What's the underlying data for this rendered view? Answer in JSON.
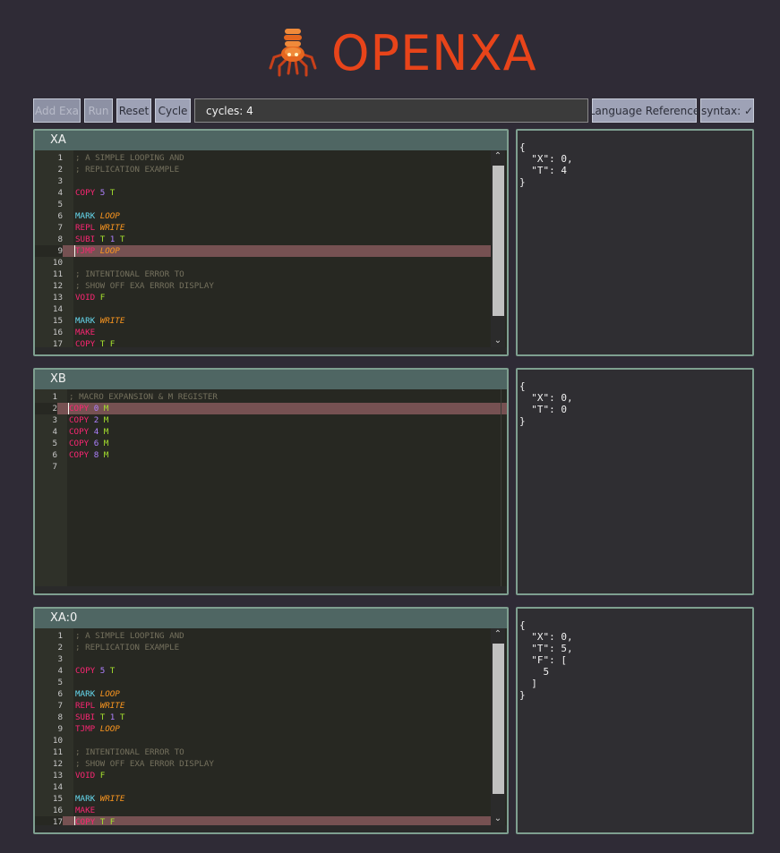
{
  "header": {
    "title": "OPENXA",
    "logo_icon": "robot-spider-icon"
  },
  "toolbar": {
    "add_exa_label": "Add Exa",
    "run_label": "Run",
    "reset_label": "Reset",
    "cycle_label": "Cycle",
    "status_text": "cycles: 4",
    "language_reference_label": "Language Reference",
    "syntax_label": "syntax: ✓"
  },
  "panels": [
    {
      "title": "XA",
      "active_line": 9,
      "cursor_line": 9,
      "lines": [
        "; A SIMPLE LOOPING AND",
        "; REPLICATION EXAMPLE",
        "",
        "COPY 5 T",
        "",
        "MARK LOOP",
        "REPL WRITE",
        "SUBI T 1 T",
        "TJMP LOOP",
        "",
        "; INTENTIONAL ERROR TO",
        "; SHOW OFF EXA ERROR DISPLAY",
        "VOID F",
        "",
        "MARK WRITE",
        "MAKE",
        "COPY T F"
      ],
      "state_json": "{\n  \"X\": 0,\n  \"T\": 4\n}"
    },
    {
      "title": "XB",
      "active_line": 2,
      "cursor_line": 2,
      "lines": [
        "; MACRO EXPANSION & M REGISTER",
        "COPY 0 M",
        "COPY 2 M",
        "COPY 4 M",
        "COPY 6 M",
        "COPY 8 M",
        ""
      ],
      "state_json": "{\n  \"X\": 0,\n  \"T\": 0\n}"
    },
    {
      "title": "XA:0",
      "active_line": 17,
      "cursor_line": 17,
      "lines": [
        "; A SIMPLE LOOPING AND",
        "; REPLICATION EXAMPLE",
        "",
        "COPY 5 T",
        "",
        "MARK LOOP",
        "REPL WRITE",
        "SUBI T 1 T",
        "TJMP LOOP",
        "",
        "; INTENTIONAL ERROR TO",
        "; SHOW OFF EXA ERROR DISPLAY",
        "VOID F",
        "",
        "MARK WRITE",
        "MAKE",
        "COPY T F"
      ],
      "state_json": "{\n  \"X\": 0,\n  \"T\": 5,\n  \"F\": [\n    5\n  ]\n}"
    }
  ],
  "colors": {
    "accent": "#e8441a",
    "panel_border": "#7e9f90",
    "panel_title_bg": "#4f6663",
    "active_line_bg": "#765152"
  }
}
